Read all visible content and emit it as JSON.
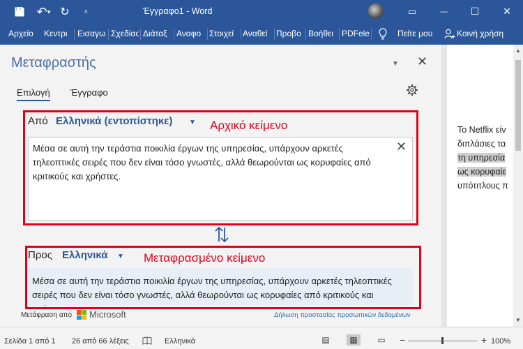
{
  "window": {
    "title": "Έγγραφο1  -  Word",
    "qa_save": "💾",
    "qa_undo": "↶",
    "qa_undo_caret": "▾",
    "qa_redo": "↻",
    "qa_customize": "⩡",
    "ribbon_display": "▭",
    "minimize": "—",
    "maximize": "☐",
    "close": "✕"
  },
  "ribbon": {
    "tabs": [
      "Αρχείο",
      "Κεντρι",
      "Εισαγω",
      "Σχεδίασ",
      "Διάταξ",
      "Αναφο",
      "Στοιχεί",
      "Αναθεί",
      "Προβο",
      "Βοήθει",
      "PDFelei"
    ],
    "tell_me": "Πείτε μου",
    "share": "Κοινή χρήση"
  },
  "pane": {
    "title": "Μεταφραστής",
    "tab_selection": "Επιλογή",
    "tab_document": "Έγγραφο",
    "from_label": "Από",
    "from_language": "Ελληνικά (εντοπίστηκε)",
    "source_annotation": "Αρχικό κείμενο",
    "source_text": "Μέσα σε αυτή την τεράστια ποικιλία έργων της υπηρεσίας, υπάρχουν αρκετές τηλεοπτικές σειρές που δεν είναι τόσο γνωστές, αλλά θεωρούνται ως κορυφαίες από κριτικούς και χρήστες.",
    "to_label": "Προς",
    "to_language": "Ελληνικά",
    "target_annotation": "Μεταφρασμένο κείμενο",
    "target_text": "Μέσα σε αυτή την τεράστια ποικιλία έργων της υπηρεσίας, υπάρχουν αρκετές τηλεοπτικές σειρές που δεν είναι τόσο γνωστές, αλλά θεωρούνται ως κορυφαίες από κριτικούς και χρήστες.",
    "translation_by": "Μετάφραση από",
    "provider": "Microsoft",
    "privacy_link": "Δήλωση προστασίας προσωπικών δεδομένων"
  },
  "document": {
    "lines": [
      "Το Netflix είν",
      "διπλάσιες τα",
      "τη υπηρεσία",
      "ως κορυφαίε",
      "υπότιτλους π"
    ]
  },
  "status": {
    "page": "Σελίδα 1 από 1",
    "words": "26 από 66 λέξεις",
    "language": "Ελληνικά",
    "zoom": "100%",
    "zoom_minus": "−",
    "zoom_plus": "+"
  },
  "colors": {
    "accent": "#2b579a",
    "annotation_red": "#e0001b"
  }
}
